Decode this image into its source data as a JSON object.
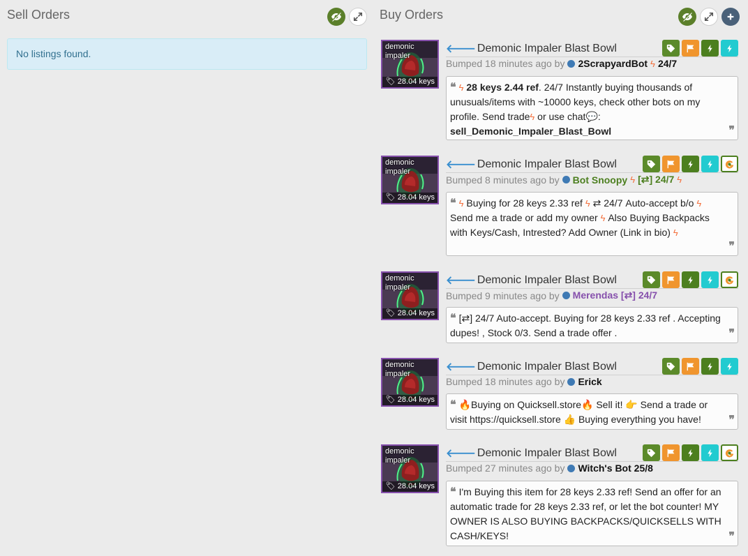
{
  "sell": {
    "title": "Sell Orders",
    "empty_message": "No listings found."
  },
  "buy": {
    "title": "Buy Orders"
  },
  "listings": [
    {
      "item_name": "Demonic Impaler Blast Bowl",
      "quality_label": "demonic impaler",
      "price": "28.04 keys",
      "bumped": "Bumped 18 minutes ago by",
      "user": "2ScrapyardBot",
      "user_suffix": "24/7",
      "comment_bold": "28 keys 2.44 ref",
      "comment_a": ". 24/7 Instantly buying thousands of unusuals/items with ~10000 keys, check other bots on my profile. Send  trade",
      "comment_b": " or  use  chat",
      "comment_c": ":",
      "comment_cmd": "sell_Demonic_Impaler_Blast_Bowl"
    },
    {
      "item_name": "Demonic Impaler Blast Bowl",
      "quality_label": "demonic impaler",
      "price": "28.04 keys",
      "bumped": "Bumped 8 minutes ago by",
      "user": "Bot Snoopy",
      "user_suffix": "[⇄] 24/7",
      "comment_a": "Buying for 28 keys 2.33 ref",
      "comment_b": "⇄ 24/7 Auto-accept b/o",
      "comment_c": "Send me a trade or add my owner",
      "comment_d": " Also Buying Backpacks with Keys/Cash, Intrested? Add Owner (Link in bio)"
    },
    {
      "item_name": "Demonic Impaler Blast Bowl",
      "quality_label": "demonic impaler",
      "price": "28.04 keys",
      "bumped": "Bumped 9 minutes ago by",
      "user": "Merendas [⇄] 24/7",
      "comment": "[⇄] 24/7 Auto-accept. Buying for 28 keys 2.33 ref . Accepting dupes! , Stock 0/3. Send a trade offer ."
    },
    {
      "item_name": "Demonic Impaler Blast Bowl",
      "quality_label": "demonic impaler",
      "price": "28.04 keys",
      "bumped": "Bumped 18 minutes ago by",
      "user": "Erick",
      "comment_a": "Buying on Quicksell.store",
      "comment_b": " Sell it! ",
      "comment_c": " Send a trade or visit https://quicksell.store ",
      "comment_d": " Buying everything you have!"
    },
    {
      "item_name": "Demonic Impaler Blast Bowl",
      "quality_label": "demonic impaler",
      "price": "28.04 keys",
      "bumped": "Bumped 27 minutes ago by",
      "user": "Witch's Bot 25/8",
      "comment": "I'm Buying this item for 28 keys 2.33 ref! Send an offer for an automatic trade for 28 keys 2.33 ref, or let the bot counter! MY OWNER IS ALSO BUYING BACKPACKS/QUICKSELLS WITH CASH/KEYS!"
    }
  ],
  "icons": {
    "visibility": "eye-slash-icon",
    "expand": "expand-icon",
    "add": "plus-icon",
    "price_tag": "tag-icon",
    "report": "flag-icon",
    "trade_offer": "bolt-icon",
    "instant": "lightning-icon",
    "marketplace": "g-icon",
    "quote": "quote-icon"
  },
  "colors": {
    "accent_green": "#5b7f2a",
    "orange": "#f0952e",
    "cyan": "#22cbd0",
    "unusual_purple": "#8650ac",
    "link_blue": "#3a8fcf"
  }
}
